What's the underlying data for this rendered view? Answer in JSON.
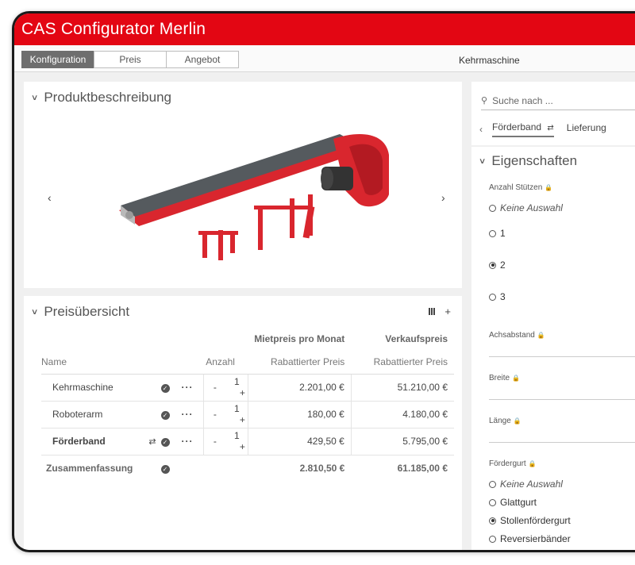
{
  "app": {
    "title": "CAS Configurator Merlin"
  },
  "tabs": [
    {
      "label": "Konfiguration",
      "active": true
    },
    {
      "label": "Preis",
      "active": false
    },
    {
      "label": "Angebot",
      "active": false
    }
  ],
  "product_name": "Kehrmaschine",
  "product_panel": {
    "title": "Produktbeschreibung",
    "prev_icon": "chevron-left-icon",
    "next_icon": "chevron-right-icon"
  },
  "price_panel": {
    "title": "Preisübersicht",
    "group_headers": {
      "rent": "Mietpreis pro Monat",
      "sale": "Verkaufspreis"
    },
    "columns": {
      "name": "Name",
      "qty": "Anzahl",
      "rent": "Rabattierter Preis",
      "sale": "Rabattierter Preis"
    },
    "rows": [
      {
        "name": "Kehrmaschine",
        "qty_minus": "-",
        "qty": "1",
        "qty_plus": "+",
        "rent": "2.201,00 €",
        "sale": "51.210,00 €"
      },
      {
        "name": "Roboterarm",
        "qty_minus": "-",
        "qty": "1",
        "qty_plus": "+",
        "rent": "180,00 €",
        "sale": "4.180,00 €"
      },
      {
        "name": "Förderband",
        "qty_minus": "-",
        "qty": "1",
        "qty_plus": "+",
        "rent": "429,50 €",
        "sale": "5.795,00 €"
      }
    ],
    "summary": {
      "name": "Zusammenfassung",
      "rent": "2.810,50 €",
      "sale": "61.185,00 €"
    }
  },
  "search": {
    "placeholder": "Suche nach ..."
  },
  "breadcrumbs": [
    {
      "label": "Förderband",
      "active": true
    },
    {
      "label": "Lieferung",
      "active": false
    }
  ],
  "properties": {
    "title": "Eigenschaften",
    "anzahl_stuetzen": {
      "label": "Anzahl Stützen",
      "options": [
        "Keine Auswahl",
        "1",
        "2",
        "3"
      ],
      "selected": "2"
    },
    "achsabstand": {
      "label": "Achsabstand",
      "value": ""
    },
    "breite": {
      "label": "Breite",
      "value": ""
    },
    "laenge": {
      "label": "Länge",
      "value": ""
    },
    "foerdergurt": {
      "label": "Fördergurt",
      "options": [
        "Keine Auswahl",
        "Glattgurt",
        "Stollenfördergurt",
        "Reversierbänder"
      ],
      "selected": "Stollenfördergurt"
    }
  },
  "colors": {
    "brand": "#e30613",
    "tab_active": "#6e6e6e",
    "panel_bg": "#ffffff",
    "app_bg": "#f0f0f0"
  }
}
